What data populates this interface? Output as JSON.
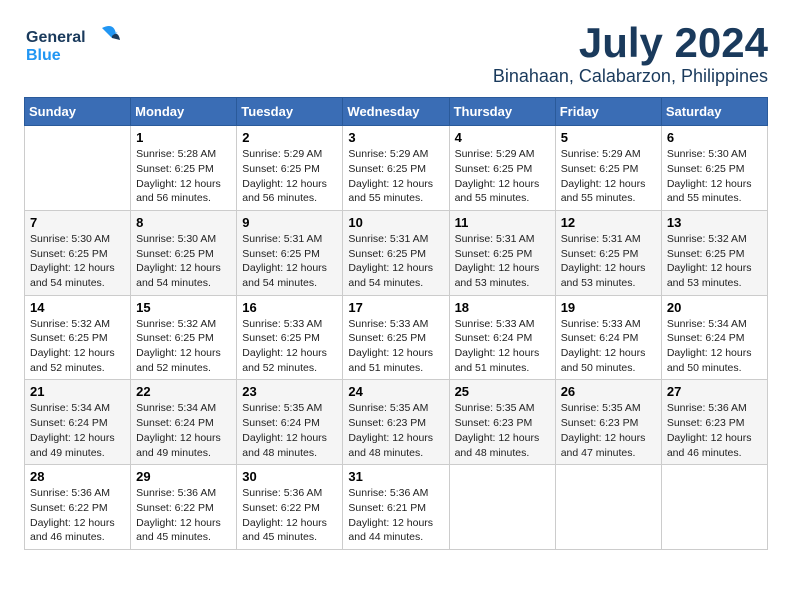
{
  "logo": {
    "line1": "General",
    "line2": "Blue"
  },
  "title": "July 2024",
  "location": "Binahaan, Calabarzon, Philippines",
  "days_header": [
    "Sunday",
    "Monday",
    "Tuesday",
    "Wednesday",
    "Thursday",
    "Friday",
    "Saturday"
  ],
  "weeks": [
    [
      {
        "day": "",
        "info": ""
      },
      {
        "day": "1",
        "info": "Sunrise: 5:28 AM\nSunset: 6:25 PM\nDaylight: 12 hours\nand 56 minutes."
      },
      {
        "day": "2",
        "info": "Sunrise: 5:29 AM\nSunset: 6:25 PM\nDaylight: 12 hours\nand 56 minutes."
      },
      {
        "day": "3",
        "info": "Sunrise: 5:29 AM\nSunset: 6:25 PM\nDaylight: 12 hours\nand 55 minutes."
      },
      {
        "day": "4",
        "info": "Sunrise: 5:29 AM\nSunset: 6:25 PM\nDaylight: 12 hours\nand 55 minutes."
      },
      {
        "day": "5",
        "info": "Sunrise: 5:29 AM\nSunset: 6:25 PM\nDaylight: 12 hours\nand 55 minutes."
      },
      {
        "day": "6",
        "info": "Sunrise: 5:30 AM\nSunset: 6:25 PM\nDaylight: 12 hours\nand 55 minutes."
      }
    ],
    [
      {
        "day": "7",
        "info": "Sunrise: 5:30 AM\nSunset: 6:25 PM\nDaylight: 12 hours\nand 54 minutes."
      },
      {
        "day": "8",
        "info": "Sunrise: 5:30 AM\nSunset: 6:25 PM\nDaylight: 12 hours\nand 54 minutes."
      },
      {
        "day": "9",
        "info": "Sunrise: 5:31 AM\nSunset: 6:25 PM\nDaylight: 12 hours\nand 54 minutes."
      },
      {
        "day": "10",
        "info": "Sunrise: 5:31 AM\nSunset: 6:25 PM\nDaylight: 12 hours\nand 54 minutes."
      },
      {
        "day": "11",
        "info": "Sunrise: 5:31 AM\nSunset: 6:25 PM\nDaylight: 12 hours\nand 53 minutes."
      },
      {
        "day": "12",
        "info": "Sunrise: 5:31 AM\nSunset: 6:25 PM\nDaylight: 12 hours\nand 53 minutes."
      },
      {
        "day": "13",
        "info": "Sunrise: 5:32 AM\nSunset: 6:25 PM\nDaylight: 12 hours\nand 53 minutes."
      }
    ],
    [
      {
        "day": "14",
        "info": "Sunrise: 5:32 AM\nSunset: 6:25 PM\nDaylight: 12 hours\nand 52 minutes."
      },
      {
        "day": "15",
        "info": "Sunrise: 5:32 AM\nSunset: 6:25 PM\nDaylight: 12 hours\nand 52 minutes."
      },
      {
        "day": "16",
        "info": "Sunrise: 5:33 AM\nSunset: 6:25 PM\nDaylight: 12 hours\nand 52 minutes."
      },
      {
        "day": "17",
        "info": "Sunrise: 5:33 AM\nSunset: 6:25 PM\nDaylight: 12 hours\nand 51 minutes."
      },
      {
        "day": "18",
        "info": "Sunrise: 5:33 AM\nSunset: 6:24 PM\nDaylight: 12 hours\nand 51 minutes."
      },
      {
        "day": "19",
        "info": "Sunrise: 5:33 AM\nSunset: 6:24 PM\nDaylight: 12 hours\nand 50 minutes."
      },
      {
        "day": "20",
        "info": "Sunrise: 5:34 AM\nSunset: 6:24 PM\nDaylight: 12 hours\nand 50 minutes."
      }
    ],
    [
      {
        "day": "21",
        "info": "Sunrise: 5:34 AM\nSunset: 6:24 PM\nDaylight: 12 hours\nand 49 minutes."
      },
      {
        "day": "22",
        "info": "Sunrise: 5:34 AM\nSunset: 6:24 PM\nDaylight: 12 hours\nand 49 minutes."
      },
      {
        "day": "23",
        "info": "Sunrise: 5:35 AM\nSunset: 6:24 PM\nDaylight: 12 hours\nand 48 minutes."
      },
      {
        "day": "24",
        "info": "Sunrise: 5:35 AM\nSunset: 6:23 PM\nDaylight: 12 hours\nand 48 minutes."
      },
      {
        "day": "25",
        "info": "Sunrise: 5:35 AM\nSunset: 6:23 PM\nDaylight: 12 hours\nand 48 minutes."
      },
      {
        "day": "26",
        "info": "Sunrise: 5:35 AM\nSunset: 6:23 PM\nDaylight: 12 hours\nand 47 minutes."
      },
      {
        "day": "27",
        "info": "Sunrise: 5:36 AM\nSunset: 6:23 PM\nDaylight: 12 hours\nand 46 minutes."
      }
    ],
    [
      {
        "day": "28",
        "info": "Sunrise: 5:36 AM\nSunset: 6:22 PM\nDaylight: 12 hours\nand 46 minutes."
      },
      {
        "day": "29",
        "info": "Sunrise: 5:36 AM\nSunset: 6:22 PM\nDaylight: 12 hours\nand 45 minutes."
      },
      {
        "day": "30",
        "info": "Sunrise: 5:36 AM\nSunset: 6:22 PM\nDaylight: 12 hours\nand 45 minutes."
      },
      {
        "day": "31",
        "info": "Sunrise: 5:36 AM\nSunset: 6:21 PM\nDaylight: 12 hours\nand 44 minutes."
      },
      {
        "day": "",
        "info": ""
      },
      {
        "day": "",
        "info": ""
      },
      {
        "day": "",
        "info": ""
      }
    ]
  ]
}
